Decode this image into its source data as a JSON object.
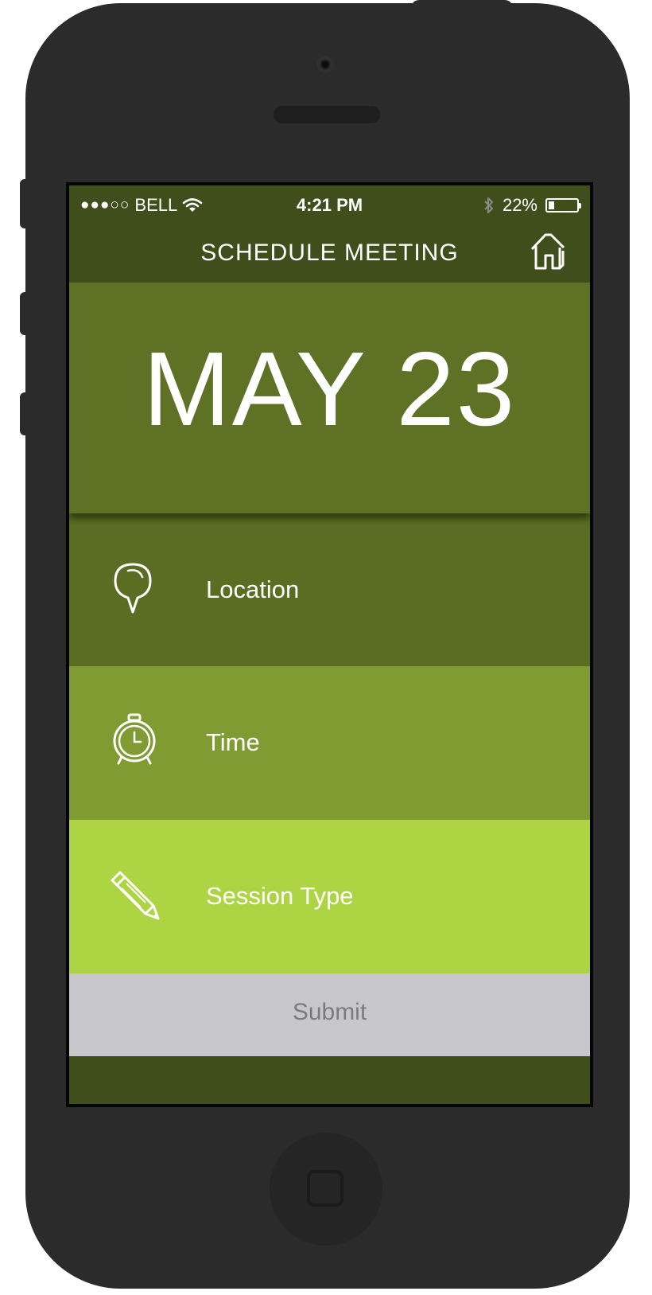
{
  "status_bar": {
    "signal": "●●●○○",
    "carrier": "BELL",
    "wifi_icon": "wifi-icon",
    "time": "4:21 PM",
    "bluetooth_icon": "bluetooth-icon",
    "battery_percent": "22%",
    "battery_level": 0.22
  },
  "nav": {
    "title": "SCHEDULE MEETING",
    "home_icon": "home-icon"
  },
  "date": {
    "display": "MAY 23"
  },
  "options": [
    {
      "label": "Location",
      "icon": "location-pin-icon",
      "color": "#5b6d22"
    },
    {
      "label": "Time",
      "icon": "alarm-clock-icon",
      "color": "#809b32"
    },
    {
      "label": "Session Type",
      "icon": "pencil-icon",
      "color": "#add442"
    }
  ],
  "submit": {
    "label": "Submit",
    "color": "#c8c8cc"
  },
  "colors": {
    "header": "#404e1b",
    "date_panel": "#5e7124",
    "phone_body": "#2a2b2a"
  }
}
